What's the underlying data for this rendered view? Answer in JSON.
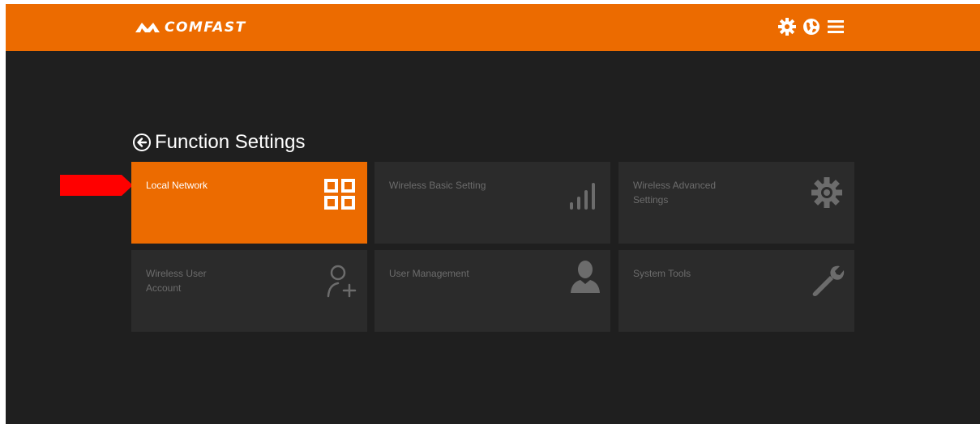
{
  "brand": {
    "name": "COMFAST"
  },
  "header": {
    "icons": [
      "gear-icon",
      "globe-icon",
      "menu-icon"
    ]
  },
  "page": {
    "title": "Function Settings"
  },
  "colors": {
    "accent": "#ec6b00",
    "background": "#1f1f1f",
    "tile": "#2b2b2b",
    "tile_text": "#6c6c6c",
    "pointer_arrow": "#ff0000"
  },
  "tiles": [
    {
      "label": "Local Network",
      "icon": "grid-icon",
      "active": true
    },
    {
      "label": "Wireless Basic Setting",
      "icon": "signal-bars-icon",
      "active": false
    },
    {
      "label": "Wireless Advanced Settings",
      "icon": "gear-icon",
      "active": false
    },
    {
      "label": "Wireless User Account",
      "icon": "add-user-icon",
      "active": false
    },
    {
      "label": "User Management",
      "icon": "user-icon",
      "active": false
    },
    {
      "label": "System Tools",
      "icon": "wrench-icon",
      "active": false
    }
  ]
}
